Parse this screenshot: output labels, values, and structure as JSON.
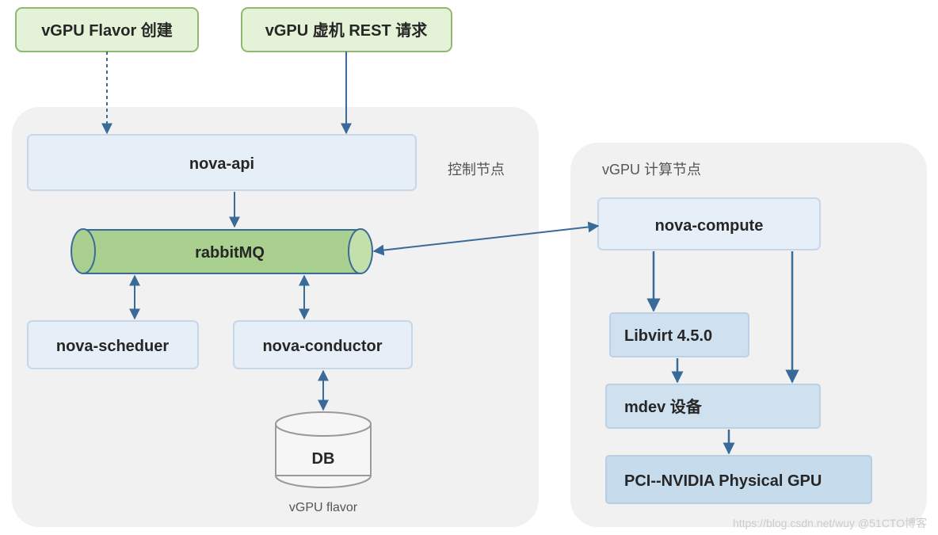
{
  "diagram": {
    "topNodes": {
      "flavorCreate": "vGPU Flavor 创建",
      "restRequest": "vGPU 虚机 REST 请求"
    },
    "controlGroup": {
      "title": "控制节点",
      "api": "nova-api",
      "rabbit": "rabbitMQ",
      "scheduler": "nova-scheduer",
      "conductor": "nova-conductor",
      "db": "DB",
      "dbCaption": "vGPU flavor"
    },
    "computeGroup": {
      "title": "vGPU 计算节点",
      "compute": "nova-compute",
      "libvirt": "Libvirt 4.5.0",
      "mdev": "mdev 设备",
      "pci": "PCI--NVIDIA Physical GPU"
    },
    "watermark": "https://blog.csdn.net/wuy @51CTO博客"
  },
  "colors": {
    "greenFill": "#e4f2d7",
    "greenStroke": "#8fb970",
    "blueFill": "#e6eff8",
    "blueStroke": "#c6d7ea",
    "blueFill2": "#cfe0ee",
    "blueFill3": "#c6dbec",
    "darkBlueText": "#225588",
    "groupFill": "#f1f1f1",
    "dbFill": "#f6f6f6",
    "dbStroke": "#9a9a9a",
    "arrow": "#3a6a9a"
  }
}
